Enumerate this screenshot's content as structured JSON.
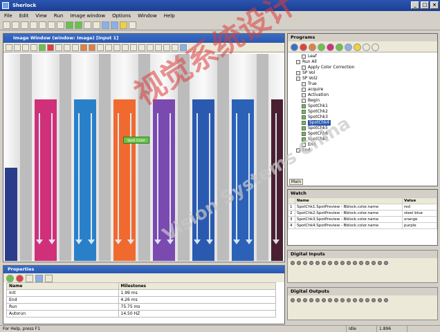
{
  "window": {
    "title": "Sherlock",
    "minimize": "_",
    "maximize": "□",
    "close": "×"
  },
  "menu": [
    "File",
    "Edit",
    "View",
    "Run",
    "Image window",
    "Options",
    "Window",
    "Help"
  ],
  "image_window": {
    "title": "Image Window (window: Image) [Input 1]"
  },
  "tubes": [
    {
      "liquid": "#2a3c8a",
      "level": 0.45
    },
    {
      "liquid": "#d0307a",
      "level": 0.78
    },
    {
      "liquid": "#2a80c8",
      "level": 0.78
    },
    {
      "liquid": "#f06a30",
      "level": 0.78
    },
    {
      "liquid": "#7a4ab0",
      "level": 0.78
    },
    {
      "liquid": "#2a5ab0",
      "level": 0.78
    },
    {
      "liquid": "#2b62b8",
      "level": 0.78
    },
    {
      "liquid": "#4a2030",
      "level": 0.78
    }
  ],
  "probe_label": "Spot Color",
  "properties": {
    "title": "Properties",
    "columns": [
      "Name",
      "Milestones"
    ],
    "rows": [
      [
        "Init",
        "1.99 ms"
      ],
      [
        "End",
        "4.26 ms"
      ],
      [
        "Run",
        "75.75 ms"
      ],
      [
        "Autorun",
        "14.50 HZ"
      ]
    ]
  },
  "programs": {
    "title": "Programs",
    "tree": [
      {
        "label": "Leaf",
        "level": 2,
        "icon": "#e8e8e8"
      },
      {
        "label": "Run All",
        "level": 1,
        "icon": "#e8e8e8"
      },
      {
        "label": "Apply Color Correction",
        "level": 2,
        "icon": "#e8e8e8"
      },
      {
        "label": "SP Vol",
        "level": 1,
        "icon": "#e8e8e8"
      },
      {
        "label": "SP Vol2",
        "level": 1,
        "icon": "#e8e8e8"
      },
      {
        "label": "True",
        "level": 2,
        "icon": "#e8e8e8"
      },
      {
        "label": "acquire",
        "level": 2,
        "icon": "#e8e8e8"
      },
      {
        "label": "Activation",
        "level": 2,
        "icon": "#e8e8e8"
      },
      {
        "label": "Begin",
        "level": 2,
        "icon": "#e8e8e8"
      },
      {
        "label": "SpotChk1",
        "level": 2,
        "icon": "#6ac24a"
      },
      {
        "label": "SpotChk2",
        "level": 2,
        "icon": "#6ac24a"
      },
      {
        "label": "SpotChk3",
        "level": 2,
        "icon": "#6ac24a"
      },
      {
        "label": "SpotChk4",
        "level": 2,
        "icon": "#6ac24a",
        "selected": true
      },
      {
        "label": "SpotChk5",
        "level": 2,
        "icon": "#6ac24a"
      },
      {
        "label": "SpotChk6",
        "level": 2,
        "icon": "#6ac24a"
      },
      {
        "label": "SpotChk7",
        "level": 2,
        "icon": "#6ac24a"
      },
      {
        "label": "End",
        "level": 2,
        "icon": "#e8e8e8"
      },
      {
        "label": "End",
        "level": 1,
        "icon": "#e8e8e8"
      }
    ],
    "tab": "Main"
  },
  "watch": {
    "title": "Watch",
    "columns": [
      "",
      "Name",
      "Value"
    ],
    "rows": [
      [
        "1",
        "SpotChk1.SpotPreview - Bblock.color.name",
        "red"
      ],
      [
        "2",
        "SpotChk2.SpotPreview - Bblock.color.name",
        "steel blue"
      ],
      [
        "3",
        "SpotChk3.SpotPreview - Bblock.color.name",
        "orange"
      ],
      [
        "4",
        "SpotChk4.SpotPreview - Bblock.color.name",
        "purple"
      ]
    ]
  },
  "digital_inputs": {
    "title": "Digital Inputs",
    "count": 16
  },
  "digital_outputs": {
    "title": "Digital Outputs",
    "count": 16
  },
  "status": {
    "left": "For Help, press F1",
    "c1": "Idle",
    "c2": "1.896",
    "c3": ""
  },
  "watermark": {
    "text1": "视觉系统设计",
    "text2": "Vision Systems China"
  }
}
